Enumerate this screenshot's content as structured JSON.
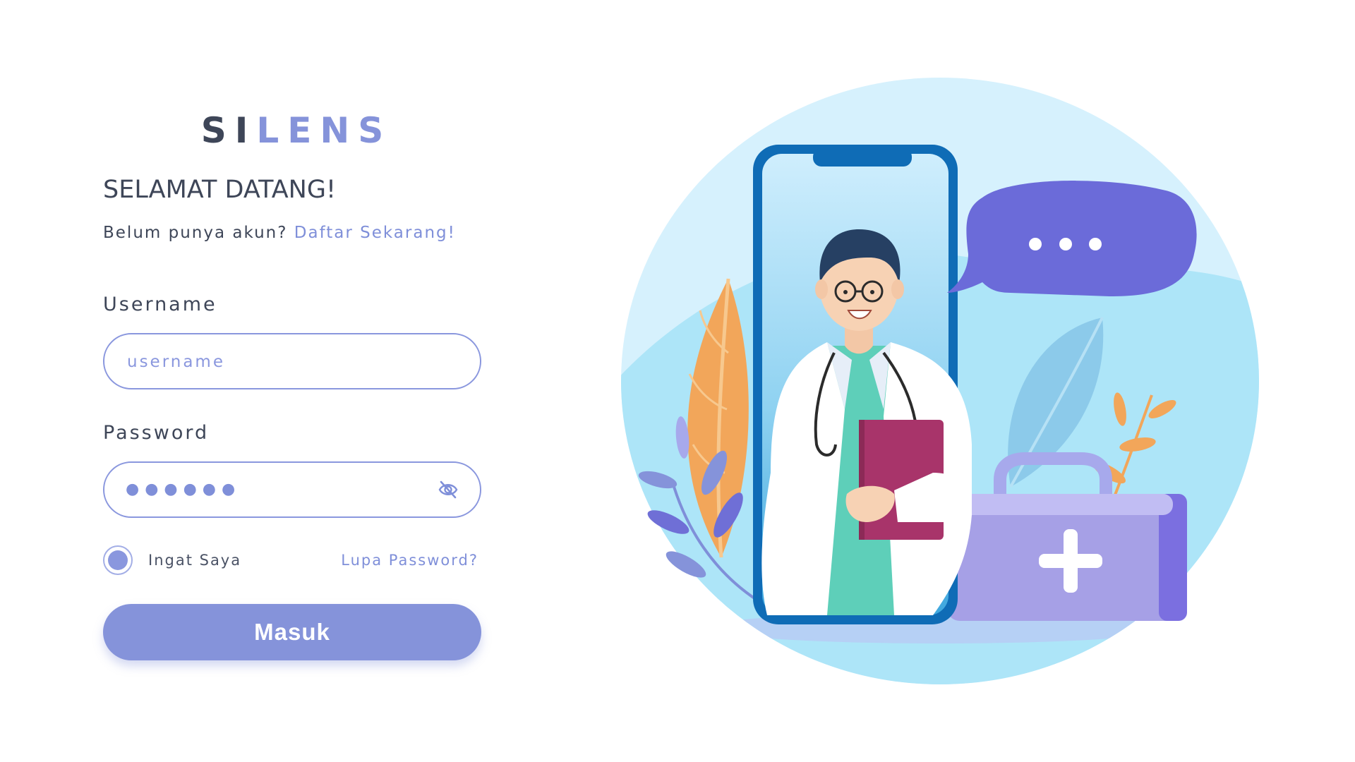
{
  "brand": {
    "logo_part1": "SI",
    "logo_part2": "LENS"
  },
  "login": {
    "title": "SELAMAT DATANG!",
    "signup_prompt": "Belum punya akun?",
    "signup_link": "Daftar Sekarang!",
    "username_label": "Username",
    "username_placeholder": "username",
    "username_value": "",
    "password_label": "Password",
    "password_masked": "●●●●●●",
    "remember_label": "Ingat Saya",
    "remember_checked": true,
    "forgot_link": "Lupa Password?",
    "submit_label": "Masuk"
  },
  "icons": {
    "password_toggle": "eye-off-icon",
    "remember_toggle": "radio-selected-icon"
  },
  "colors": {
    "primary": "#8593da",
    "text_dark": "#3e4658",
    "link": "#7f8fd9",
    "illustration_bg": "#cfeefd"
  }
}
